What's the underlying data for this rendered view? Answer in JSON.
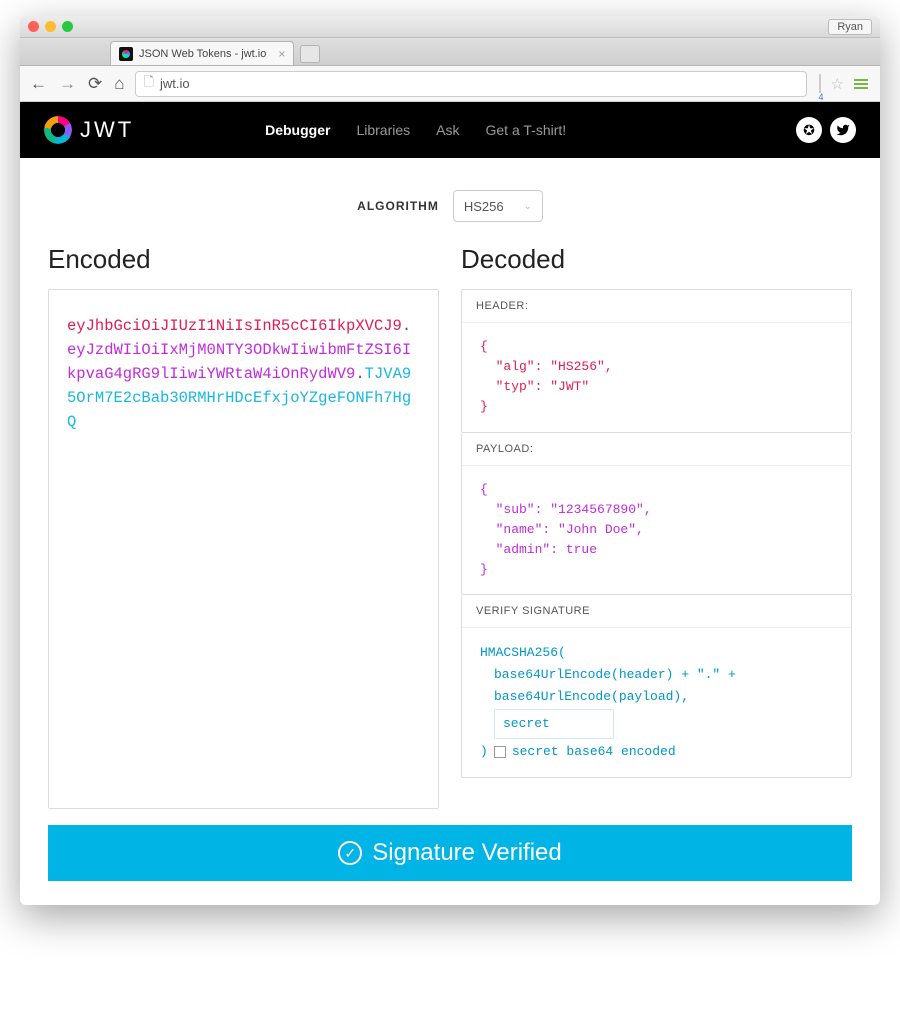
{
  "titlebar": {
    "user": "Ryan"
  },
  "tab": {
    "title": "JSON Web Tokens - jwt.io"
  },
  "omnibox": {
    "url": "jwt.io",
    "sub": "4"
  },
  "nav": {
    "debugger": "Debugger",
    "libraries": "Libraries",
    "ask": "Ask",
    "tshirt": "Get a T-shirt!"
  },
  "logo_text": "JWT",
  "algorithm": {
    "label": "ALGORITHM",
    "value": "HS256"
  },
  "headings": {
    "encoded": "Encoded",
    "decoded": "Decoded"
  },
  "encoded": {
    "header": "eyJhbGciOiJIUzI1NiIsInR5cCI6IkpXVCJ9",
    "payload": "eyJzdWIiOiIxMjM0NTY3ODkwIiwibmFtZSI6IkpvaG4gRG9lIiwiYWRtaW4iOnRydWV9",
    "signature": "TJVA95OrM7E2cBab30RMHrHDcEfxjoYZgeFONFh7HgQ"
  },
  "sections": {
    "header": "HEADER:",
    "payload": "PAYLOAD:",
    "verify": "VERIFY SIGNATURE"
  },
  "header_json": "{\n  \"alg\": \"HS256\",\n  \"typ\": \"JWT\"\n}",
  "payload_json": "{\n  \"sub\": \"1234567890\",\n  \"name\": \"John Doe\",\n  \"admin\": true\n}",
  "signature_block": {
    "l1": "HMACSHA256(",
    "l2": "base64UrlEncode(header) + \".\" +",
    "l3": "base64UrlEncode(payload),",
    "secret": "secret",
    "l5": ")",
    "cb_label": "secret base64 encoded"
  },
  "verify_bar": "Signature Verified"
}
